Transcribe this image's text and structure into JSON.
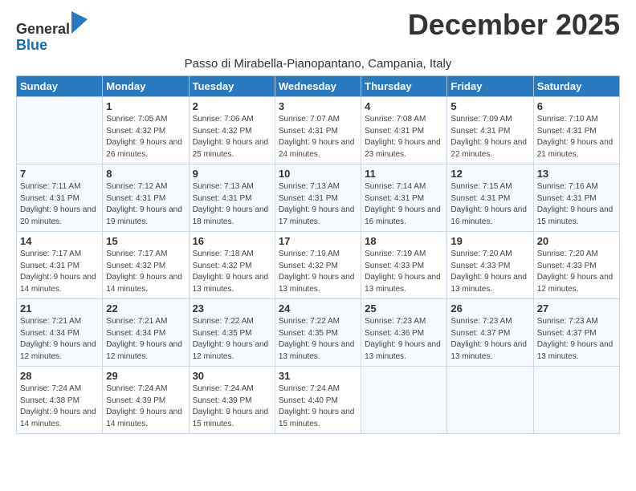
{
  "logo": {
    "text1": "General",
    "text2": "Blue"
  },
  "title": "December 2025",
  "subtitle": "Passo di Mirabella-Pianopantano, Campania, Italy",
  "weekdays": [
    "Sunday",
    "Monday",
    "Tuesday",
    "Wednesday",
    "Thursday",
    "Friday",
    "Saturday"
  ],
  "weeks": [
    [
      {
        "day": "",
        "sunrise": "",
        "sunset": "",
        "daylight": ""
      },
      {
        "day": "1",
        "sunrise": "Sunrise: 7:05 AM",
        "sunset": "Sunset: 4:32 PM",
        "daylight": "Daylight: 9 hours and 26 minutes."
      },
      {
        "day": "2",
        "sunrise": "Sunrise: 7:06 AM",
        "sunset": "Sunset: 4:32 PM",
        "daylight": "Daylight: 9 hours and 25 minutes."
      },
      {
        "day": "3",
        "sunrise": "Sunrise: 7:07 AM",
        "sunset": "Sunset: 4:31 PM",
        "daylight": "Daylight: 9 hours and 24 minutes."
      },
      {
        "day": "4",
        "sunrise": "Sunrise: 7:08 AM",
        "sunset": "Sunset: 4:31 PM",
        "daylight": "Daylight: 9 hours and 23 minutes."
      },
      {
        "day": "5",
        "sunrise": "Sunrise: 7:09 AM",
        "sunset": "Sunset: 4:31 PM",
        "daylight": "Daylight: 9 hours and 22 minutes."
      },
      {
        "day": "6",
        "sunrise": "Sunrise: 7:10 AM",
        "sunset": "Sunset: 4:31 PM",
        "daylight": "Daylight: 9 hours and 21 minutes."
      }
    ],
    [
      {
        "day": "7",
        "sunrise": "Sunrise: 7:11 AM",
        "sunset": "Sunset: 4:31 PM",
        "daylight": "Daylight: 9 hours and 20 minutes."
      },
      {
        "day": "8",
        "sunrise": "Sunrise: 7:12 AM",
        "sunset": "Sunset: 4:31 PM",
        "daylight": "Daylight: 9 hours and 19 minutes."
      },
      {
        "day": "9",
        "sunrise": "Sunrise: 7:13 AM",
        "sunset": "Sunset: 4:31 PM",
        "daylight": "Daylight: 9 hours and 18 minutes."
      },
      {
        "day": "10",
        "sunrise": "Sunrise: 7:13 AM",
        "sunset": "Sunset: 4:31 PM",
        "daylight": "Daylight: 9 hours and 17 minutes."
      },
      {
        "day": "11",
        "sunrise": "Sunrise: 7:14 AM",
        "sunset": "Sunset: 4:31 PM",
        "daylight": "Daylight: 9 hours and 16 minutes."
      },
      {
        "day": "12",
        "sunrise": "Sunrise: 7:15 AM",
        "sunset": "Sunset: 4:31 PM",
        "daylight": "Daylight: 9 hours and 16 minutes."
      },
      {
        "day": "13",
        "sunrise": "Sunrise: 7:16 AM",
        "sunset": "Sunset: 4:31 PM",
        "daylight": "Daylight: 9 hours and 15 minutes."
      }
    ],
    [
      {
        "day": "14",
        "sunrise": "Sunrise: 7:17 AM",
        "sunset": "Sunset: 4:31 PM",
        "daylight": "Daylight: 9 hours and 14 minutes."
      },
      {
        "day": "15",
        "sunrise": "Sunrise: 7:17 AM",
        "sunset": "Sunset: 4:32 PM",
        "daylight": "Daylight: 9 hours and 14 minutes."
      },
      {
        "day": "16",
        "sunrise": "Sunrise: 7:18 AM",
        "sunset": "Sunset: 4:32 PM",
        "daylight": "Daylight: 9 hours and 13 minutes."
      },
      {
        "day": "17",
        "sunrise": "Sunrise: 7:19 AM",
        "sunset": "Sunset: 4:32 PM",
        "daylight": "Daylight: 9 hours and 13 minutes."
      },
      {
        "day": "18",
        "sunrise": "Sunrise: 7:19 AM",
        "sunset": "Sunset: 4:33 PM",
        "daylight": "Daylight: 9 hours and 13 minutes."
      },
      {
        "day": "19",
        "sunrise": "Sunrise: 7:20 AM",
        "sunset": "Sunset: 4:33 PM",
        "daylight": "Daylight: 9 hours and 13 minutes."
      },
      {
        "day": "20",
        "sunrise": "Sunrise: 7:20 AM",
        "sunset": "Sunset: 4:33 PM",
        "daylight": "Daylight: 9 hours and 12 minutes."
      }
    ],
    [
      {
        "day": "21",
        "sunrise": "Sunrise: 7:21 AM",
        "sunset": "Sunset: 4:34 PM",
        "daylight": "Daylight: 9 hours and 12 minutes."
      },
      {
        "day": "22",
        "sunrise": "Sunrise: 7:21 AM",
        "sunset": "Sunset: 4:34 PM",
        "daylight": "Daylight: 9 hours and 12 minutes."
      },
      {
        "day": "23",
        "sunrise": "Sunrise: 7:22 AM",
        "sunset": "Sunset: 4:35 PM",
        "daylight": "Daylight: 9 hours and 12 minutes."
      },
      {
        "day": "24",
        "sunrise": "Sunrise: 7:22 AM",
        "sunset": "Sunset: 4:35 PM",
        "daylight": "Daylight: 9 hours and 13 minutes."
      },
      {
        "day": "25",
        "sunrise": "Sunrise: 7:23 AM",
        "sunset": "Sunset: 4:36 PM",
        "daylight": "Daylight: 9 hours and 13 minutes."
      },
      {
        "day": "26",
        "sunrise": "Sunrise: 7:23 AM",
        "sunset": "Sunset: 4:37 PM",
        "daylight": "Daylight: 9 hours and 13 minutes."
      },
      {
        "day": "27",
        "sunrise": "Sunrise: 7:23 AM",
        "sunset": "Sunset: 4:37 PM",
        "daylight": "Daylight: 9 hours and 13 minutes."
      }
    ],
    [
      {
        "day": "28",
        "sunrise": "Sunrise: 7:24 AM",
        "sunset": "Sunset: 4:38 PM",
        "daylight": "Daylight: 9 hours and 14 minutes."
      },
      {
        "day": "29",
        "sunrise": "Sunrise: 7:24 AM",
        "sunset": "Sunset: 4:39 PM",
        "daylight": "Daylight: 9 hours and 14 minutes."
      },
      {
        "day": "30",
        "sunrise": "Sunrise: 7:24 AM",
        "sunset": "Sunset: 4:39 PM",
        "daylight": "Daylight: 9 hours and 15 minutes."
      },
      {
        "day": "31",
        "sunrise": "Sunrise: 7:24 AM",
        "sunset": "Sunset: 4:40 PM",
        "daylight": "Daylight: 9 hours and 15 minutes."
      },
      {
        "day": "",
        "sunrise": "",
        "sunset": "",
        "daylight": ""
      },
      {
        "day": "",
        "sunrise": "",
        "sunset": "",
        "daylight": ""
      },
      {
        "day": "",
        "sunrise": "",
        "sunset": "",
        "daylight": ""
      }
    ]
  ]
}
